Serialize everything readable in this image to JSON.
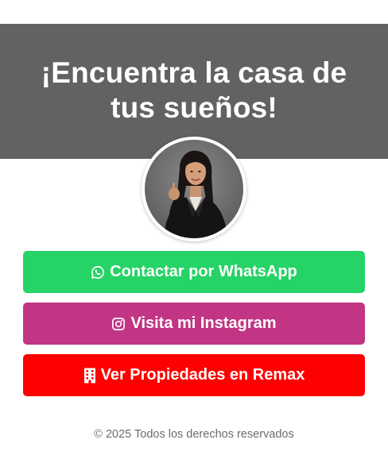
{
  "hero": {
    "title_line1": "¡Encuentra la casa de",
    "title_line2": "tus sueños!",
    "background_color": "#626262"
  },
  "profile": {
    "avatar_icon": "profile-photo"
  },
  "buttons": {
    "whatsapp": {
      "label": "Contactar por WhatsApp",
      "icon": "whatsapp-icon",
      "color": "#25d366"
    },
    "instagram": {
      "label": "Visita mi Instagram",
      "icon": "instagram-icon",
      "color": "#c13584"
    },
    "remax": {
      "label": "Ver Propiedades en Remax",
      "icon": "building-icon",
      "color": "#ff0000"
    }
  },
  "footer": {
    "text": "© 2025 Todos los derechos reservados"
  }
}
